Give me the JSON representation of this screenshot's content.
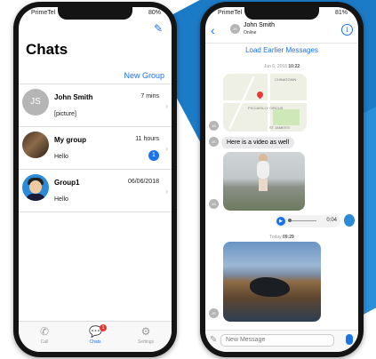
{
  "colors": {
    "accent": "#1a73e8",
    "badge": "#1a73e8",
    "tab_badge": "#e53935"
  },
  "left_phone": {
    "status": {
      "carrier": "PrimeTel",
      "battery": "80%"
    },
    "title": "Chats",
    "new_group": "New Group",
    "chats": [
      {
        "avatar_initials": "JS",
        "name": "John  Smith",
        "time": "7 mins",
        "message": "[picture]",
        "unread": null,
        "avatar": "initials"
      },
      {
        "avatar_initials": "",
        "name": "My group",
        "time": "11 hours",
        "message": "Hello",
        "unread": "1",
        "avatar": "photo"
      },
      {
        "avatar_initials": "",
        "name": "Group1",
        "time": "06/06/2018",
        "message": "Hello",
        "unread": null,
        "avatar": "cartoon"
      }
    ],
    "tabs": [
      {
        "label": "Call",
        "icon": "phone-icon"
      },
      {
        "label": "Chats",
        "icon": "chat-bubbles-icon",
        "badge": "1"
      },
      {
        "label": "Settings",
        "icon": "gears-icon"
      }
    ]
  },
  "right_phone": {
    "status": {
      "carrier": "PrimeTel",
      "battery": "81%"
    },
    "contact": {
      "initials": "JS",
      "name": "John  Smith",
      "status": "Online"
    },
    "load_earlier": "Load Earlier Messages",
    "stamp1_date": "Jun 6, 2018",
    "stamp1_time": "10:22",
    "map_labels": [
      "CHINATOWN",
      "PICCADILLY CIRCUS",
      "ST JAMES'S"
    ],
    "bubble_text": "Here is a video as well",
    "audio_duration": "0:04",
    "stamp2_date": "Today",
    "stamp2_time": "09:29",
    "input_placeholder": "New Message",
    "avatar_initials": "JS"
  }
}
